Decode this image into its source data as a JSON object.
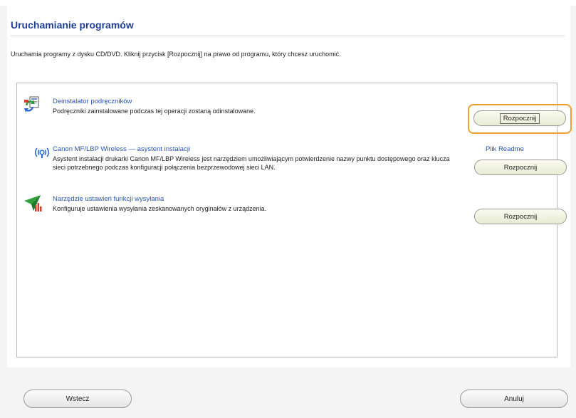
{
  "header": {
    "title": "Uruchamianie programów",
    "intro": "Uruchamia programy z dysku CD/DVD. Kliknij przycisk [Rozpocznij] na prawo od programu, który chcesz uruchomić."
  },
  "programs": [
    {
      "icon": "uninstall-manuals-icon",
      "title": "Deinstalator podręczników",
      "description": "Podręczniki zainstalowane podczas tej operacji zostaną odinstalowane.",
      "button": "Rozpocznij"
    },
    {
      "icon": "wireless-icon",
      "title": "Canon MF/LBP Wireless — asystent instalacji",
      "description": "Asystent instalacji drukarki Canon MF/LBP Wireless jest narzędziem umożliwiającym potwierdzenie nazwy punktu dostępowego oraz klucza sieci potrzebnego podczas konfiguracji połączenia bezprzewodowej sieci LAN.",
      "link": "Plik Readme",
      "button": "Rozpocznij"
    },
    {
      "icon": "send-settings-icon",
      "title": "Narzędzie ustawień funkcji wysyłania",
      "description": "Konfiguruje ustawienia wysyłania zeskanowanych oryginałów z urządzenia.",
      "button": "Rozpocznij"
    }
  ],
  "footer": {
    "back": "Wstecz",
    "cancel": "Anuluj"
  },
  "colors": {
    "title": "#1f3f9a",
    "link": "#2a55b8",
    "focus_highlight": "#f0a030"
  }
}
